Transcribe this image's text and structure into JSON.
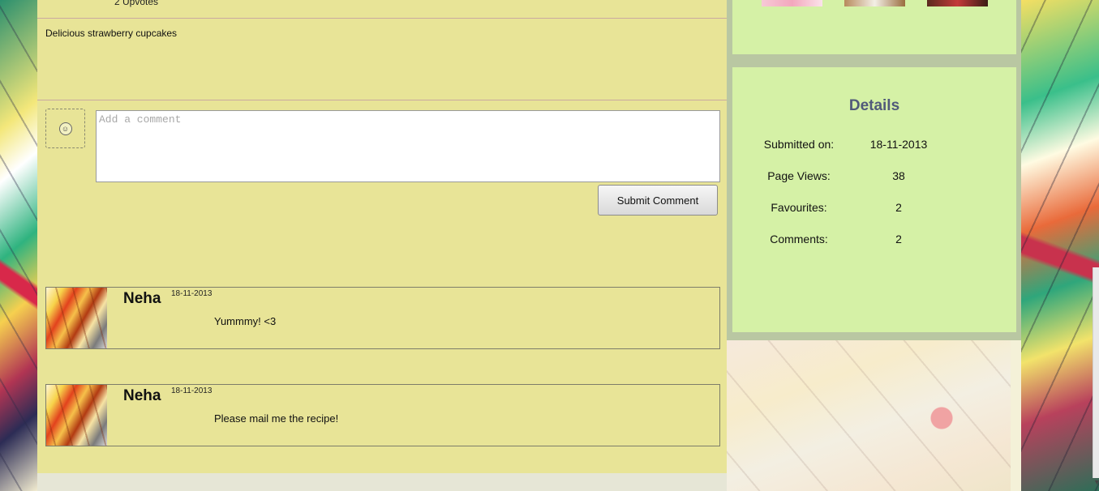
{
  "post": {
    "upvotes": "2 Upvotes",
    "description": "Delicious strawberry cupcakes"
  },
  "comment_form": {
    "placeholder": "Add a comment",
    "submit_label": "Submit Comment",
    "avatar_icon": "smiley-icon"
  },
  "comments": [
    {
      "author": "Neha",
      "date": "18-11-2013",
      "text": "Yummmy! <3"
    },
    {
      "author": "Neha",
      "date": "18-11-2013",
      "text": "Please mail me the recipe!"
    }
  ],
  "details": {
    "title": "Details",
    "rows": [
      {
        "label": "Submitted on:",
        "value": "18-11-2013"
      },
      {
        "label": "Page Views:",
        "value": "38"
      },
      {
        "label": "Favourites:",
        "value": "2"
      },
      {
        "label": "Comments:",
        "value": "2"
      }
    ]
  },
  "colors": {
    "main_bg": "#e8e497",
    "sidebar_bg": "#d5f1a6",
    "sidebar_frame": "#b9c7a2",
    "details_title": "#515a7a"
  }
}
